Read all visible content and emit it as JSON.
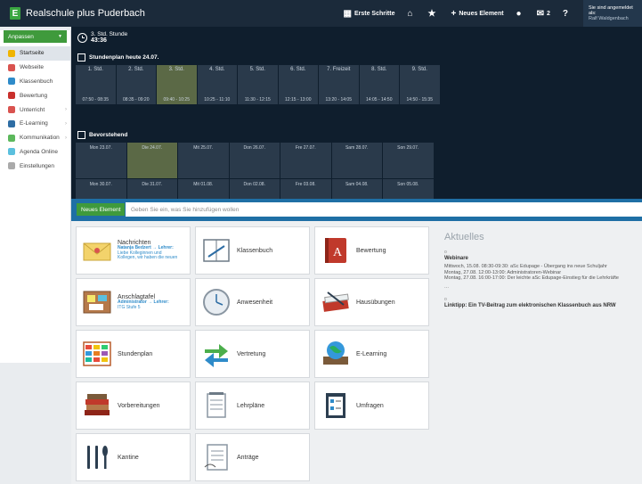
{
  "app": {
    "title": "Realschule plus Puderbach",
    "logo_letter": "E"
  },
  "topbar": {
    "first_steps": "Erste Schritte",
    "home_icon": "home-icon",
    "star_icon": "star-icon",
    "new_element": "Neues Element",
    "messages_count": "2",
    "help": "?",
    "login_line1": "Sie sind angemeldet als:",
    "login_line2": "Ralf Waldgenbach"
  },
  "sidebar": {
    "customize": "Anpassen",
    "items": [
      {
        "label": "Startseite",
        "icon": "star-icon",
        "color": "#f0b400"
      },
      {
        "label": "Webseite",
        "icon": "globe-icon",
        "color": "#d9534f"
      },
      {
        "label": "Klassenbuch",
        "icon": "book-icon",
        "color": "#2e8bc9"
      },
      {
        "label": "Bewertung",
        "icon": "grade-icon",
        "color": "#c9302c"
      },
      {
        "label": "Unterricht",
        "icon": "teaching-icon",
        "color": "#d9534f"
      },
      {
        "label": "E-Learning",
        "icon": "elearning-icon",
        "color": "#2e6da4"
      },
      {
        "label": "Kommunikation",
        "icon": "communication-icon",
        "color": "#5cb85c"
      },
      {
        "label": "Agenda Online",
        "icon": "agenda-icon",
        "color": "#5bc0de"
      },
      {
        "label": "Einstellungen",
        "icon": "settings-icon",
        "color": "#aaaaaa"
      }
    ]
  },
  "current": {
    "hour": "3. Std. Stunde",
    "time": "43:36"
  },
  "schedule": {
    "title": "Stundenplan heute 24.07.",
    "periods": [
      {
        "name": "1. Std.",
        "time": "07:50 - 08:35"
      },
      {
        "name": "2. Std.",
        "time": "08:35 - 09:20"
      },
      {
        "name": "3. Std.",
        "time": "09:40 - 10:25"
      },
      {
        "name": "4. Std.",
        "time": "10:25 - 11:10"
      },
      {
        "name": "5. Std.",
        "time": "11:30 - 12:15"
      },
      {
        "name": "6. Std.",
        "time": "12:15 - 13:00"
      },
      {
        "name": "7. Freizeit",
        "time": "13:20 - 14:05"
      },
      {
        "name": "8. Std.",
        "time": "14:05 - 14:50"
      },
      {
        "name": "9. Std.",
        "time": "14:50 - 15:35"
      }
    ]
  },
  "upcoming": {
    "title": "Bevorstehend",
    "days": [
      "Mon 23.07.",
      "Die 24.07.",
      "Mit 25.07.",
      "Don 26.07.",
      "Fre 27.07.",
      "Sam 28.07.",
      "Son 29.07.",
      "Mon 30.07.",
      "Die 31.07.",
      "Mit 01.08.",
      "Don 02.08.",
      "Fre 03.08.",
      "Sam 04.08.",
      "Son 05.08."
    ]
  },
  "quickbar": {
    "button": "Neues Element",
    "placeholder": "Geben Sie ein, was Sie hinzufügen wollen"
  },
  "tiles": {
    "nachrichten": {
      "label": "Nachrichten",
      "sub1": "Natanja Bedzert → Lehrer:",
      "sub2": "Liebe Kolleginnen und",
      "sub3": "Kollegen, wir haben die neuen"
    },
    "klassenbuch": "Klassenbuch",
    "bewertung": "Bewertung",
    "anschlagtafel": {
      "label": "Anschlagtafel",
      "sub1": "Administrator → Lehrer:",
      "sub2": "ITG Stufe 5"
    },
    "anwesenheit": "Anwesenheit",
    "hausuebungen": "Hausübungen",
    "stundenplan": "Stundenplan",
    "vertretung": "Vertretung",
    "elearning": "E-Learning",
    "vorbereitungen": "Vorbereitungen",
    "lehrplaene": "Lehrpläne",
    "umfragen": "Umfragen",
    "kantine": "Kantine",
    "antraege": "Anträge"
  },
  "news": {
    "title": "Aktuelles",
    "item1_title": "Webinare",
    "item1_lines": [
      "Mittwoch, 15.08. 08:30-09:30: aSc Edupage - Übergang ins neue Schuljahr",
      "Montag, 27.08. 12:00-13:00: Administratoren-Webinar",
      "Montag, 27.08. 16:00-17:00: Der leichte aSc Edupage-Einstieg für die Lehrkräfte"
    ],
    "dots": "...",
    "item2_title": "Linktipp: Ein TV-Beitrag zum elektronischen Klassenbuch aus NRW"
  },
  "colors": {
    "topbar": "#1b2a3a",
    "dark": "#0f1e2d",
    "accent_green": "#3f9a3c",
    "accent_blue": "#1f6fa5",
    "current_period": "#5b6946"
  }
}
